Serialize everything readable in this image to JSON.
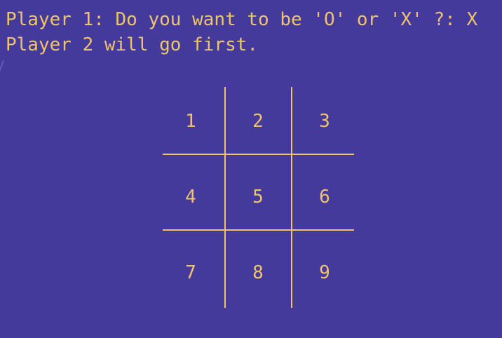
{
  "terminal": {
    "prompt_line": "Player 1: Do you want to be 'O' or 'X' ?: X",
    "info_line": "Player 2 will go first."
  },
  "board": {
    "cells": [
      "1",
      "2",
      "3",
      "4",
      "5",
      "6",
      "7",
      "8",
      "9"
    ]
  },
  "colors": {
    "background": "#443a9c",
    "text": "#f0c36a"
  }
}
